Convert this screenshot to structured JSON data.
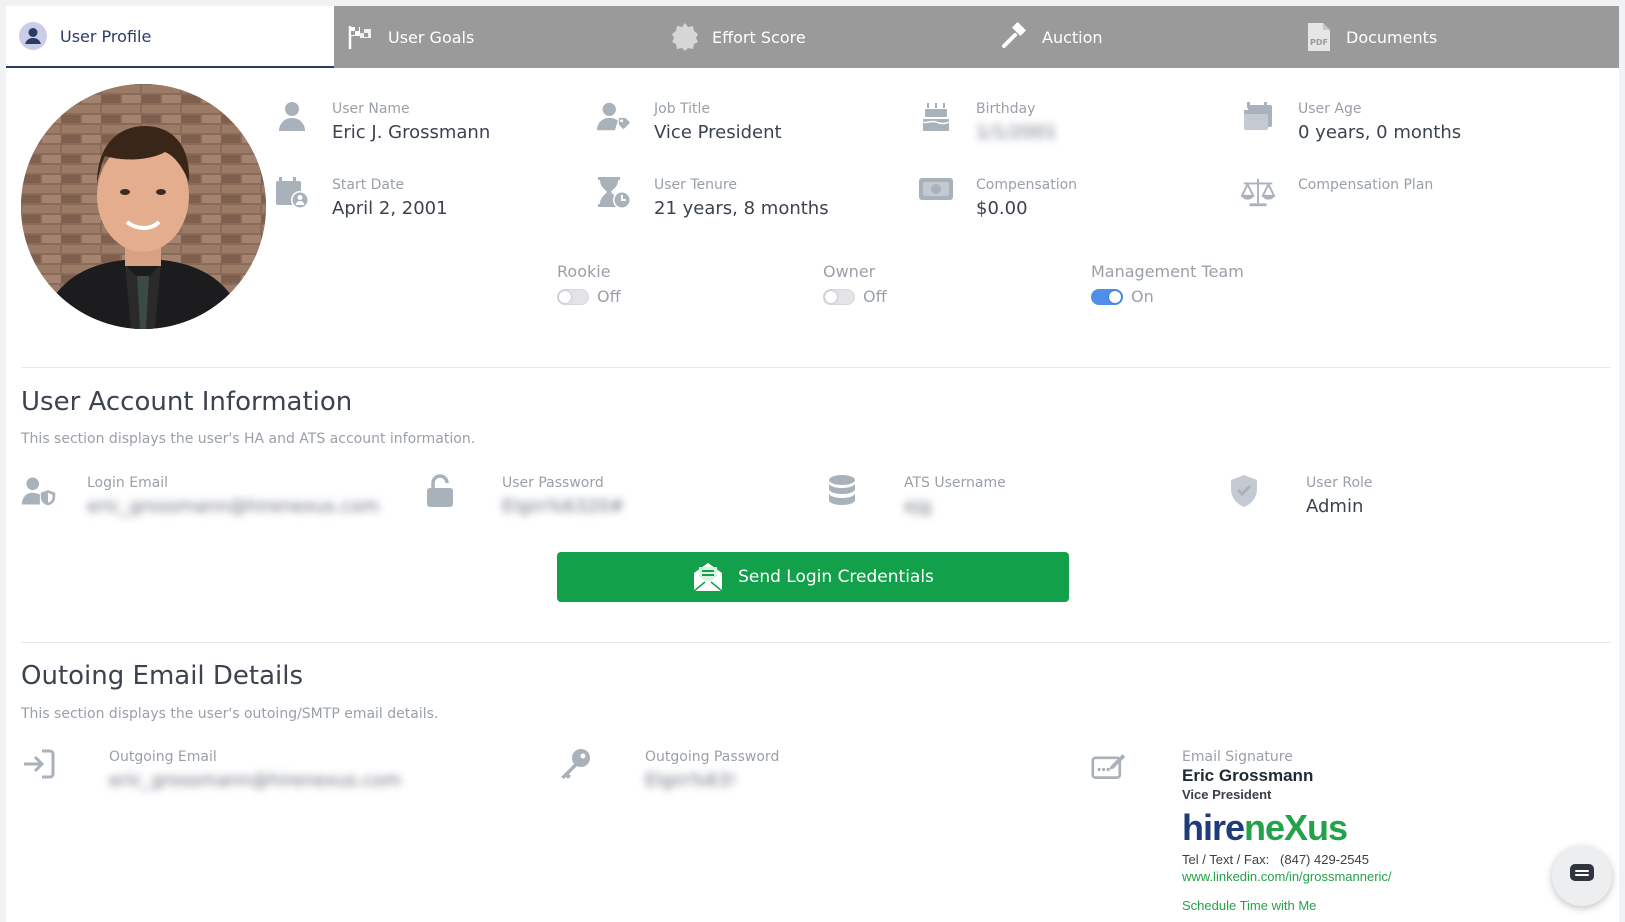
{
  "tabs": [
    {
      "label": "User Profile",
      "icon": "user-circle-icon"
    },
    {
      "label": "User Goals",
      "icon": "flags-icon"
    },
    {
      "label": "Effort Score",
      "icon": "badge-icon"
    },
    {
      "label": "Auction",
      "icon": "gavel-icon"
    },
    {
      "label": "Documents",
      "icon": "pdf-icon"
    }
  ],
  "profile": {
    "user_name": {
      "label": "User Name",
      "value": "Eric J. Grossmann"
    },
    "job_title": {
      "label": "Job Title",
      "value": "Vice President"
    },
    "birthday": {
      "label": "Birthday",
      "value": "1/1/2001"
    },
    "user_age": {
      "label": "User Age",
      "value": "0 years, 0 months"
    },
    "start_date": {
      "label": "Start Date",
      "value": "April 2, 2001"
    },
    "user_tenure": {
      "label": "User Tenure",
      "value": "21 years, 8 months"
    },
    "compensation": {
      "label": "Compensation",
      "value": "$0.00"
    },
    "compensation_plan": {
      "label": "Compensation Plan",
      "value": ""
    }
  },
  "toggles": {
    "rookie": {
      "label": "Rookie",
      "state": "Off",
      "on": false
    },
    "owner": {
      "label": "Owner",
      "state": "Off",
      "on": false
    },
    "management": {
      "label": "Management Team",
      "state": "On",
      "on": true
    }
  },
  "account": {
    "title": "User Account Information",
    "description": "This section displays the user's HA and ATS account information.",
    "login_email": {
      "label": "Login Email",
      "value": "eric_grossmann@hirenexus.com"
    },
    "user_password": {
      "label": "User Password",
      "value": "Elgin%6320#"
    },
    "ats_username": {
      "label": "ATS Username",
      "value": "ejg"
    },
    "user_role": {
      "label": "User Role",
      "value": "Admin"
    },
    "send_button": "Send Login Credentials"
  },
  "outgoing": {
    "title": "Outoing Email Details",
    "description": "This section displays the user's outoing/SMTP email details.",
    "email": {
      "label": "Outgoing Email",
      "value": "eric_grossmann@hirenexus.com"
    },
    "password": {
      "label": "Outgoing Password",
      "value": "Elgin%63!"
    },
    "signature": {
      "label": "Email Signature",
      "name": "Eric Grossmann",
      "title": "Vice President",
      "logo_part1": "hire",
      "logo_part2": "neXus",
      "phone_label": "Tel / Text / Fax:",
      "phone": "(847) 429-2545",
      "linkedin": "www.linkedin.com/in/grossmanneric/",
      "schedule": "Schedule Time with Me"
    }
  },
  "colors": {
    "tab_bar": "#9a9a9a",
    "active_tab_text": "#2b3a67",
    "send_button": "#13a04a",
    "toggle_on": "#4f8fe8",
    "icon_gray": "#a9b1bb",
    "logo_blue": "#1f3b7a",
    "logo_green": "#23a24a"
  }
}
